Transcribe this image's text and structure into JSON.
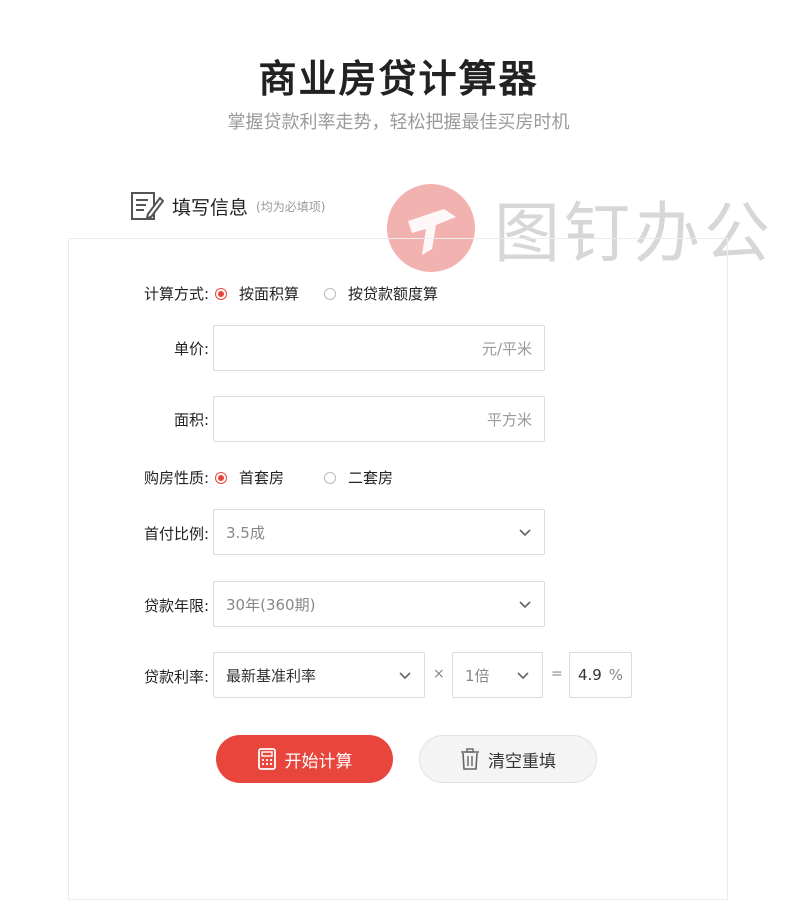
{
  "header": {
    "title": "商业房贷计算器",
    "subtitle": "掌握贷款利率走势，轻松把握最佳买房时机"
  },
  "section": {
    "title": "填写信息",
    "hint": "(均为必填项)"
  },
  "watermark": {
    "text": "图钉办公"
  },
  "form": {
    "calc_method": {
      "label": "计算方式:",
      "options": [
        "按面积算",
        "按贷款额度算"
      ],
      "selected": "按面积算"
    },
    "unit_price": {
      "label": "单价:",
      "value": "",
      "unit": "元/平米"
    },
    "area": {
      "label": "面积:",
      "value": "",
      "unit": "平方米"
    },
    "property_type": {
      "label": "购房性质:",
      "options": [
        "首套房",
        "二套房"
      ],
      "selected": "首套房"
    },
    "down_payment": {
      "label": "首付比例:",
      "selected": "3.5成"
    },
    "loan_term": {
      "label": "贷款年限:",
      "selected": "30年(360期)"
    },
    "rate": {
      "label": "贷款利率:",
      "base_selected": "最新基准利率",
      "times_symbol": "×",
      "multiplier_selected": "1倍",
      "equals_symbol": "=",
      "value": "4.9",
      "unit": "%"
    }
  },
  "buttons": {
    "calculate": "开始计算",
    "reset": "清空重填"
  },
  "colors": {
    "accent": "#e8453c",
    "border": "#dcdcdc",
    "muted": "#999999"
  },
  "icons": {
    "section": "edit-form-icon",
    "calculate": "calculator-icon",
    "reset": "trash-icon",
    "dropdown": "chevron-down-icon"
  }
}
